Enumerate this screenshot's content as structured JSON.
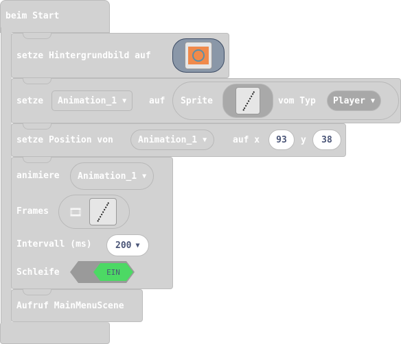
{
  "hat": {
    "label": "beim Start"
  },
  "block1": {
    "label": "setze Hintergrundbild auf",
    "icon": "background-image-thumbnail"
  },
  "block2": {
    "label_set": "setze",
    "variable": "Animation_1",
    "label_to": "auf",
    "sprite_label": "Sprite",
    "kind_label": "vom Typ",
    "kind": "Player"
  },
  "block3": {
    "label": "setze Position von",
    "variable": "Animation_1",
    "label_x": "auf x",
    "x": "93",
    "label_y": "y",
    "y": "38"
  },
  "block4": {
    "label": "animiere",
    "variable": "Animation_1",
    "frames_label": "Frames",
    "interval_label": "Intervall (ms)",
    "interval": "200",
    "loop_label": "Schleife",
    "loop": "EIN"
  },
  "block5": {
    "label": "Aufruf MainMenuScene"
  },
  "colors": {
    "block": "#d2d2d2",
    "toggle_on": "#4cd964",
    "image_field": "#8a97a8"
  }
}
